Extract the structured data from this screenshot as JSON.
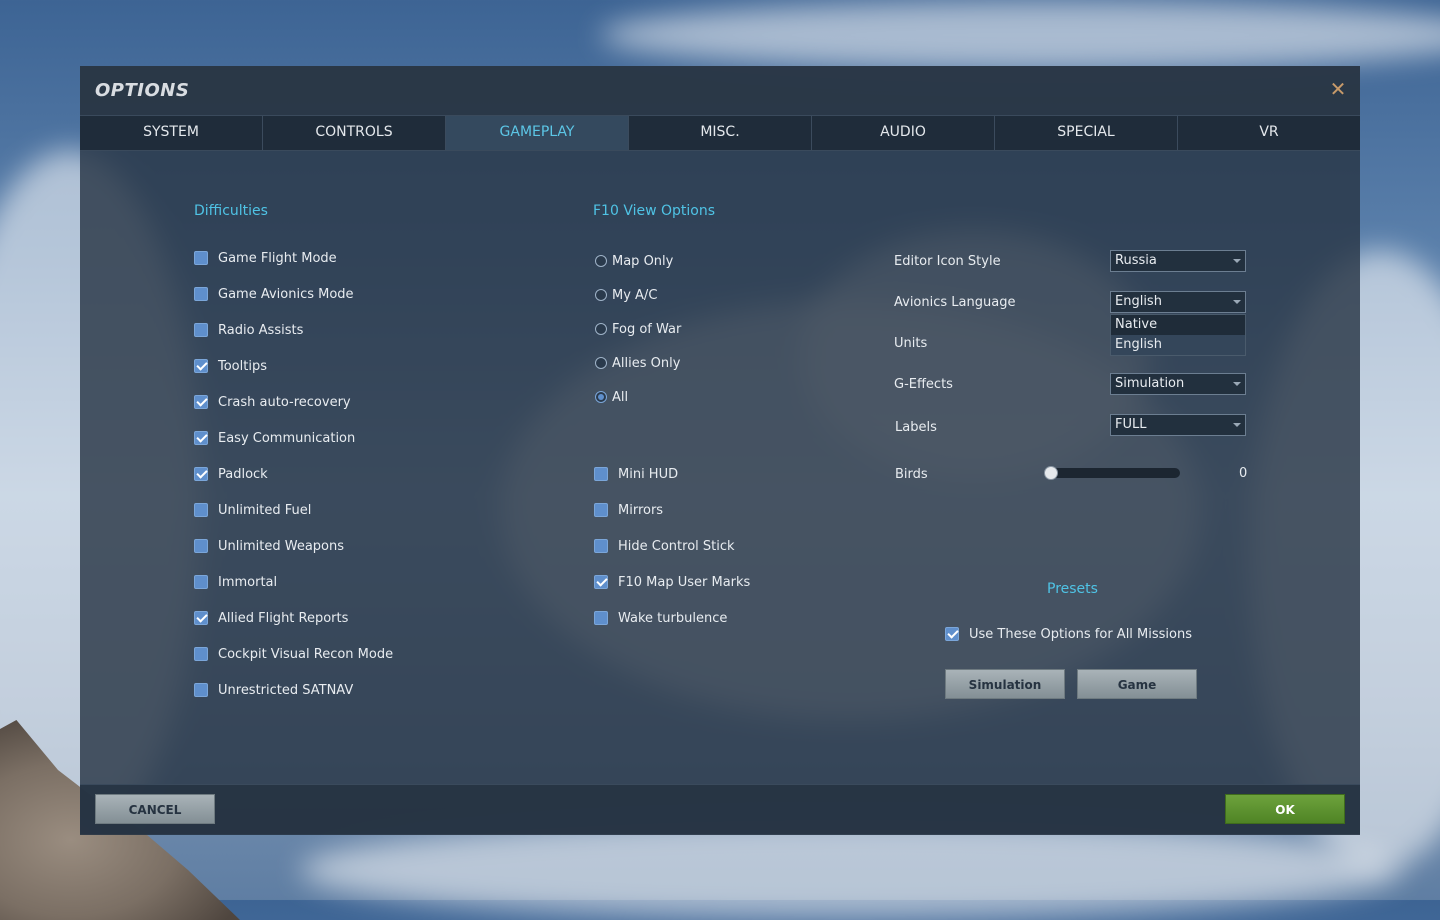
{
  "dialog": {
    "title": "OPTIONS",
    "close_glyph": "✕"
  },
  "tabs": [
    {
      "label": "SYSTEM"
    },
    {
      "label": "CONTROLS"
    },
    {
      "label": "GAMEPLAY",
      "active": true
    },
    {
      "label": "MISC."
    },
    {
      "label": "AUDIO"
    },
    {
      "label": "SPECIAL"
    },
    {
      "label": "VR"
    }
  ],
  "difficulties": {
    "title": "Difficulties",
    "items": [
      {
        "label": "Game Flight Mode",
        "checked": false
      },
      {
        "label": "Game Avionics Mode",
        "checked": false
      },
      {
        "label": "Radio Assists",
        "checked": false
      },
      {
        "label": "Tooltips",
        "checked": true
      },
      {
        "label": "Crash auto-recovery",
        "checked": true
      },
      {
        "label": "Easy Communication",
        "checked": true
      },
      {
        "label": "Padlock",
        "checked": true
      },
      {
        "label": "Unlimited Fuel",
        "checked": false
      },
      {
        "label": "Unlimited Weapons",
        "checked": false
      },
      {
        "label": "Immortal",
        "checked": false
      },
      {
        "label": "Allied Flight Reports",
        "checked": true
      },
      {
        "label": "Cockpit Visual Recon Mode",
        "checked": false
      },
      {
        "label": "Unrestricted SATNAV",
        "checked": false
      }
    ]
  },
  "f10": {
    "title": "F10 View Options",
    "radios": [
      {
        "label": "Map Only",
        "selected": false
      },
      {
        "label": "My A/C",
        "selected": false
      },
      {
        "label": "Fog of War",
        "selected": false
      },
      {
        "label": "Allies Only",
        "selected": false
      },
      {
        "label": "All",
        "selected": true
      }
    ],
    "checks": [
      {
        "label": "Mini HUD",
        "checked": false
      },
      {
        "label": "Mirrors",
        "checked": false
      },
      {
        "label": "Hide Control Stick",
        "checked": false
      },
      {
        "label": "F10 Map User Marks",
        "checked": true
      },
      {
        "label": "Wake turbulence",
        "checked": false
      }
    ]
  },
  "settings": {
    "editor_icon_style": {
      "label": "Editor Icon Style",
      "value": "Russia"
    },
    "avionics_language": {
      "label": "Avionics Language",
      "value": "English",
      "options": [
        "Native",
        "English"
      ],
      "selected_option": "English"
    },
    "units": {
      "label": "Units"
    },
    "g_effects": {
      "label": "G-Effects",
      "value": "Simulation"
    },
    "labels": {
      "label": "Labels",
      "value": "FULL"
    },
    "birds": {
      "label": "Birds",
      "value": "0",
      "level": 0
    }
  },
  "presets": {
    "title": "Presets",
    "use_all": {
      "label": "Use These Options for All Missions",
      "checked": true
    },
    "simulation_button": "Simulation",
    "game_button": "Game"
  },
  "footer": {
    "cancel_label": "CANCEL",
    "ok_label": "OK"
  }
}
